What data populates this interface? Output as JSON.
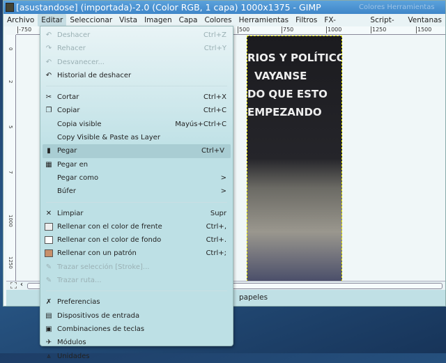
{
  "window": {
    "title": "[asustandose] (importada)-2.0 (Color RGB, 1 capa) 1000x1375 - GIMP",
    "background_title": "Colores   Herramientas"
  },
  "menubar": [
    "Archivo",
    "Editar",
    "Seleccionar",
    "Vista",
    "Imagen",
    "Capa",
    "Colores",
    "Herramientas",
    "Filtros",
    "FX-Foundry",
    "Script-Fu",
    "Ventanas"
  ],
  "hruler": [
    "-750",
    "500",
    "750",
    "1000",
    "1250",
    "1500"
  ],
  "vruler": [
    "0",
    "2",
    "5",
    "7",
    "1000",
    "1250"
  ],
  "image_text": [
    "RIOS Y POLÍTICOS",
    "VAYANSE",
    "DO QUE ESTO",
    "EMPEZANDO"
  ],
  "status": "papeles",
  "edit_menu": [
    {
      "label": "Deshacer",
      "shortcut": "Ctrl+Z",
      "icon": "undo-icon",
      "disabled": true
    },
    {
      "label": "Rehacer",
      "shortcut": "Ctrl+Y",
      "icon": "redo-icon",
      "disabled": true
    },
    {
      "label": "Desvanecer...",
      "shortcut": "",
      "icon": "fade-icon",
      "disabled": true
    },
    {
      "label": "Historial de deshacer",
      "shortcut": "",
      "icon": "undo-history-icon"
    },
    {
      "sep": true
    },
    {
      "label": "Cortar",
      "shortcut": "Ctrl+X",
      "icon": "scissors-icon"
    },
    {
      "label": "Copiar",
      "shortcut": "Ctrl+C",
      "icon": "copy-icon"
    },
    {
      "label": "Copia visible",
      "shortcut": "Mayús+Ctrl+C"
    },
    {
      "label": "Copy Visible & Paste as Layer",
      "shortcut": ""
    },
    {
      "label": "Pegar",
      "shortcut": "Ctrl+V",
      "icon": "paste-icon",
      "highlighted": true
    },
    {
      "label": "Pegar en",
      "shortcut": "",
      "icon": "paste-into-icon"
    },
    {
      "label": "Pegar como",
      "shortcut": ">"
    },
    {
      "label": "Búfer",
      "shortcut": ">"
    },
    {
      "sep": true
    },
    {
      "label": "Limpiar",
      "shortcut": "Supr",
      "icon": "clear-icon"
    },
    {
      "label": "Rellenar con el color de frente",
      "shortcut": "Ctrl+,",
      "icon": "fill-fg-icon"
    },
    {
      "label": "Rellenar con el color de fondo",
      "shortcut": "Ctrl+.",
      "icon": "fill-bg-icon"
    },
    {
      "label": "Rellenar con un patrón",
      "shortcut": "Ctrl+;",
      "icon": "fill-pattern-icon"
    },
    {
      "label": "Trazar selección [Stroke]...",
      "shortcut": "",
      "icon": "stroke-selection-icon",
      "disabled": true
    },
    {
      "label": "Trazar ruta...",
      "shortcut": "",
      "icon": "stroke-path-icon",
      "disabled": true
    },
    {
      "sep": true
    },
    {
      "label": "Preferencias",
      "shortcut": "",
      "icon": "preferences-icon"
    },
    {
      "label": "Dispositivos de entrada",
      "shortcut": "",
      "icon": "input-devices-icon"
    },
    {
      "label": "Combinaciones de teclas",
      "shortcut": "",
      "icon": "keyboard-icon"
    },
    {
      "label": "Módulos",
      "shortcut": "",
      "icon": "modules-icon"
    },
    {
      "label": "Unidades",
      "shortcut": "",
      "icon": "units-icon"
    }
  ]
}
